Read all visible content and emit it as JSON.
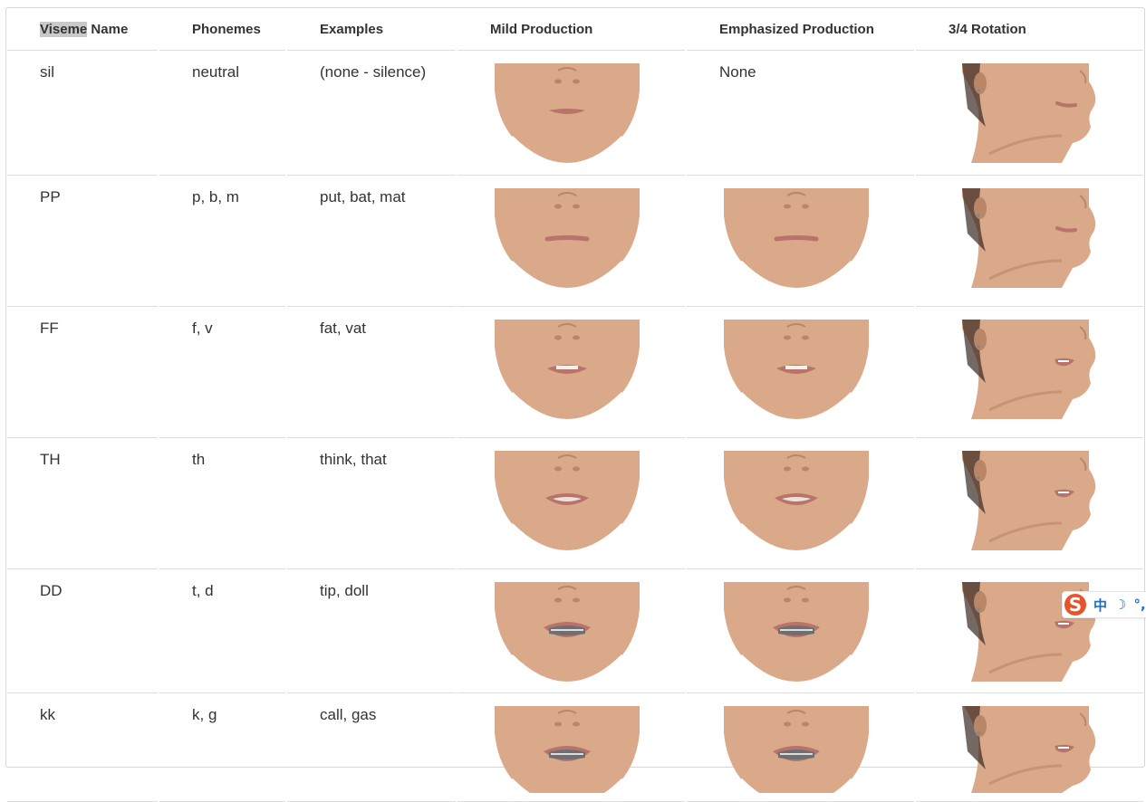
{
  "table": {
    "headers": {
      "viseme_prefix": "Viseme",
      "viseme_suffix": " Name",
      "phonemes": "Phonemes",
      "examples": "Examples",
      "mild": "Mild Production",
      "emphasized": "Emphasized Production",
      "rotation": "3/4 Rotation"
    },
    "rows": [
      {
        "viseme": "sil",
        "phonemes": "neutral",
        "examples": "(none - silence)",
        "emphasized_text": "None",
        "mouth": "closed"
      },
      {
        "viseme": "PP",
        "phonemes": "p, b, m",
        "examples": "put, bat, mat",
        "mouth": "pressed"
      },
      {
        "viseme": "FF",
        "phonemes": "f, v",
        "examples": "fat, vat",
        "mouth": "teeth-lip"
      },
      {
        "viseme": "TH",
        "phonemes": "th",
        "examples": "think, that",
        "mouth": "tongue"
      },
      {
        "viseme": "DD",
        "phonemes": "t, d",
        "examples": "tip, doll",
        "mouth": "open-teeth"
      },
      {
        "viseme": "kk",
        "phonemes": "k, g",
        "examples": "call, gas",
        "mouth": "open-teeth"
      }
    ]
  },
  "ime_toolbar": {
    "logo": "S",
    "lang": "中",
    "moon_icon": "☽",
    "punct": "°,"
  },
  "colors": {
    "skin": "#d9a98a",
    "skin_shadow": "#b98668",
    "lips": "#b8736a",
    "hair": "#3b2a22"
  }
}
